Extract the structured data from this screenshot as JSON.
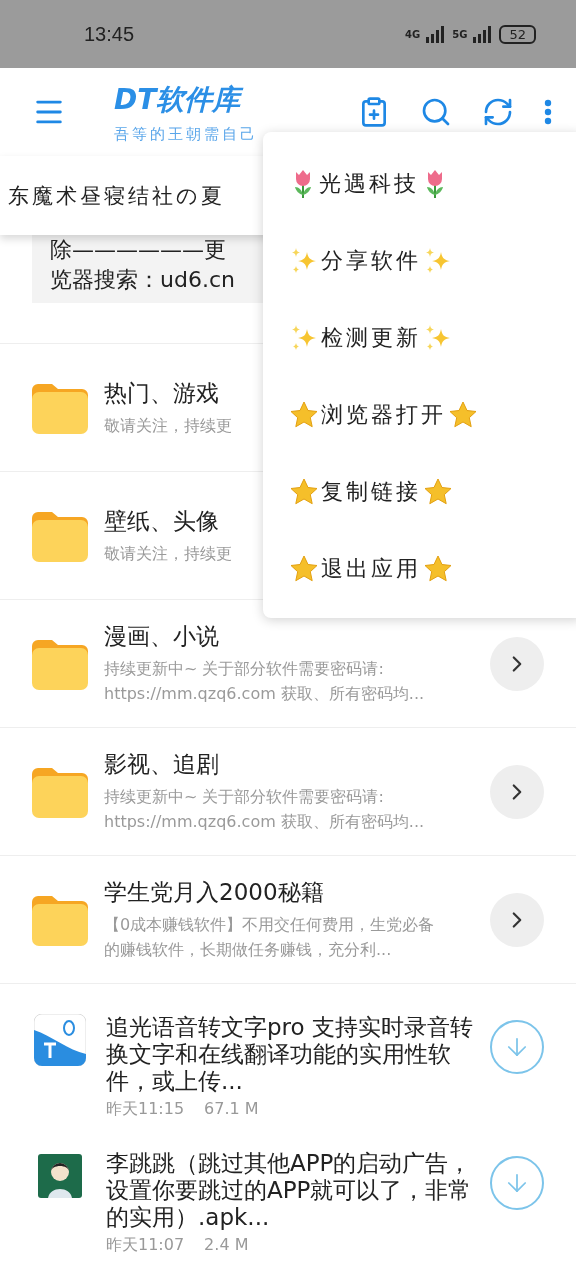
{
  "status_bar": {
    "time": "13:45",
    "network_1": "4G",
    "network_2": "5G",
    "battery": "52"
  },
  "app_bar": {
    "title": "DT软件库",
    "subtitle": "吾等的王朝需自己"
  },
  "marquee": {
    "text": "东魔术昼寝结社の夏"
  },
  "notice": {
    "lines": [
      "除——————更",
      "览器搜索：ud6.cn"
    ]
  },
  "folders": [
    {
      "title": "热门、游戏",
      "subtitle": [
        "敬请关注，持续更"
      ]
    },
    {
      "title": "壁纸、头像",
      "subtitle": [
        "敬请关注，持续更"
      ]
    },
    {
      "title": "漫画、小说",
      "subtitle": [
        "持续更新中~ 关于部分软件需要密码请:",
        "https://mm.qzq6.com 获取、所有密码均..."
      ]
    },
    {
      "title": "影视、追剧",
      "subtitle": [
        "持续更新中~ 关于部分软件需要密码请:",
        "https://mm.qzq6.com 获取、所有密码均..."
      ]
    },
    {
      "title": "学生党月入2000秘籍",
      "subtitle": [
        "【0成本赚钱软件】不用交任何费用，生党必备",
        "的赚钱软件，长期做任务赚钱，充分利..."
      ]
    }
  ],
  "apps": [
    {
      "kind": "voice",
      "title": "追光语音转文字pro 支持实时录音转换文字和在线翻译功能的实用性软件，或上传...",
      "time": "昨天11:15",
      "size": "67.1 M"
    },
    {
      "kind": "figure",
      "title": "李跳跳（跳过其他APP的启动广告，设置你要跳过的APP就可以了，非常的实用）.apk...",
      "time": "昨天11:07",
      "size": "2.4 M"
    }
  ],
  "menu": {
    "items": [
      {
        "kind": "tulip",
        "label": "光遇科技"
      },
      {
        "kind": "sparkle",
        "label": "分享软件"
      },
      {
        "kind": "sparkle",
        "label": "检测更新"
      },
      {
        "kind": "star",
        "label": "浏览器打开"
      },
      {
        "kind": "star",
        "label": "复制链接"
      },
      {
        "kind": "star",
        "label": "退出应用"
      }
    ]
  }
}
